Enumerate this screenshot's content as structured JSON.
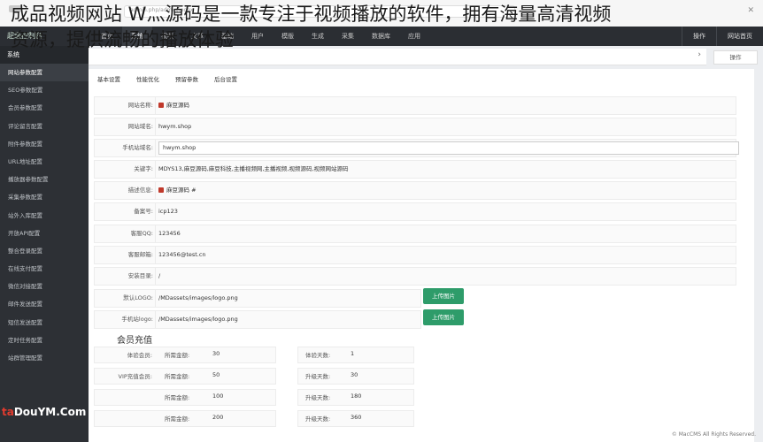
{
  "headline": {
    "line1": "成品视频网站 W灬源码是一款专注于视频播放的软件，拥有海量高清视频",
    "line2": "资源，提供流畅的播放体验"
  },
  "browser": {
    "url": "admin.php/admin/index"
  },
  "watermark": {
    "red": "ta",
    "white": "DouYM.Com"
  },
  "topnav": {
    "brand": "超级控制台",
    "items": [
      "首页",
      "系统",
      "视频",
      "文章",
      "基础",
      "用户",
      "模版",
      "生成",
      "采集",
      "数据库",
      "应用"
    ],
    "active_index": 1,
    "right": [
      "操作",
      "网站首页"
    ]
  },
  "sidebar": {
    "title": "系统",
    "items": [
      "网站参数配置",
      "SEO参数配置",
      "会员参数配置",
      "评论留言配置",
      "附件参数配置",
      "URL地址配置",
      "播放器参数配置",
      "采集参数配置",
      "站外入库配置",
      "开放API配置",
      "整合登录配置",
      "在线支付配置",
      "微信对接配置",
      "邮件发送配置",
      "短信发送配置",
      "定时任务配置",
      "站群管理配置"
    ],
    "active_index": 0
  },
  "toolbar": {
    "chevron": "›",
    "operate": "操作"
  },
  "content_tabs": [
    "基本设置",
    "性能优化",
    "预留参数",
    "后台设置"
  ],
  "fields": [
    {
      "label": "网站名称:",
      "value": "麻豆源码",
      "icon": true
    },
    {
      "label": "网站域名:",
      "value": "hwym.shop"
    },
    {
      "label": "手机站域名:",
      "value": "hwym.shop",
      "boxed": true
    },
    {
      "label": "关键字:",
      "value": "MDYS13,麻豆源码,麻豆科技,主播视频网,主播视频,视频源码,视频网站源码"
    },
    {
      "label": "描述信息:",
      "value": "麻豆源码 #",
      "icon": true
    },
    {
      "label": "备案号:",
      "value": "icp123"
    },
    {
      "label": "客服QQ:",
      "value": "123456"
    },
    {
      "label": "客服邮箱:",
      "value": "123456@test.cn"
    },
    {
      "label": "安装目录:",
      "value": "/"
    },
    {
      "label": "默认LOGO:",
      "value": "/MDassets/images/logo.png"
    },
    {
      "label": "手机站logo:",
      "value": "/MDassets/images/logo.png"
    }
  ],
  "upload_label": "上传图片",
  "member": {
    "title": "会员充值",
    "rows": [
      {
        "label": "体验会员:",
        "price_label": "所需金额:",
        "price": "30",
        "days_label": "体验天数:",
        "days": "1"
      },
      {
        "label": "VIP充值会员:",
        "price_label": "所需金额:",
        "price": "50",
        "days_label": "升级天数:",
        "days": "30"
      },
      {
        "label": "",
        "price_label": "所需金额:",
        "price": "100",
        "days_label": "升级天数:",
        "days": "180"
      },
      {
        "label": "",
        "price_label": "所需金额:",
        "price": "200",
        "days_label": "升级天数:",
        "days": "360"
      }
    ]
  },
  "footer": "© MacCMS All Rights Reserved."
}
